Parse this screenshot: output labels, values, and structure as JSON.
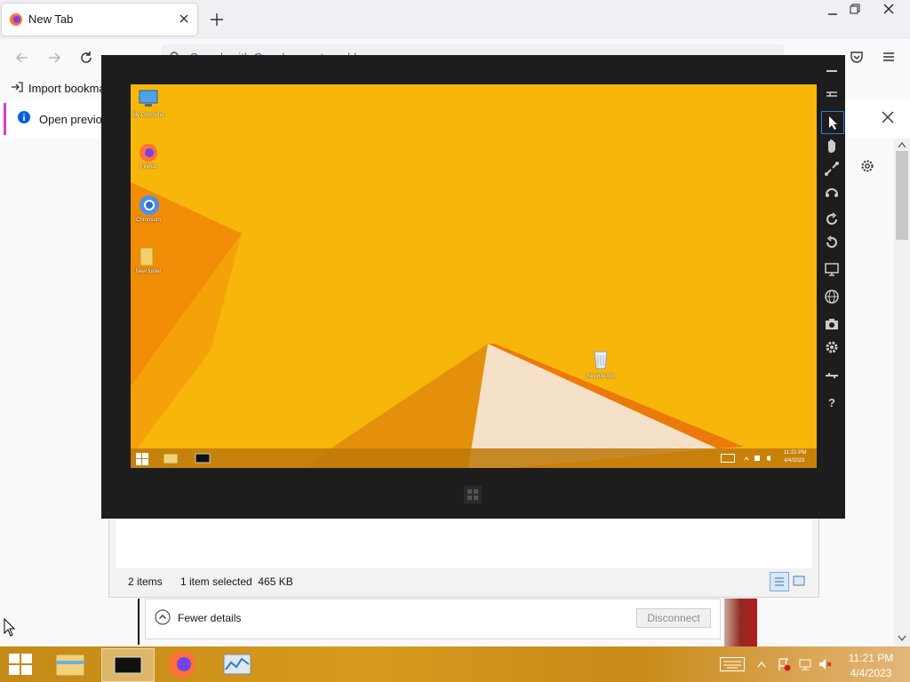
{
  "browser": {
    "tab_title": "New Tab",
    "url_placeholder": "Search with Google or enter address",
    "bookmark_import": "Import bookmarks",
    "notification_text": "Open previous tabs?"
  },
  "remote_desktop": {
    "desktop_icons": [
      {
        "label": "My Computer"
      },
      {
        "label": "Firefox"
      },
      {
        "label": "Chromium"
      },
      {
        "label": "New folder"
      }
    ],
    "recycle_bin_label": "Recycle Bin",
    "tray_time": "11:21 PM",
    "tray_date": "4/4/2023"
  },
  "explorer": {
    "item_count": "2 items",
    "selection": "1 item selected  465 KB"
  },
  "rdp": {
    "fewer_details": "Fewer details",
    "disconnect": "Disconnect"
  },
  "taskbar": {
    "time": "11:21 PM",
    "date": "4/4/2023"
  }
}
